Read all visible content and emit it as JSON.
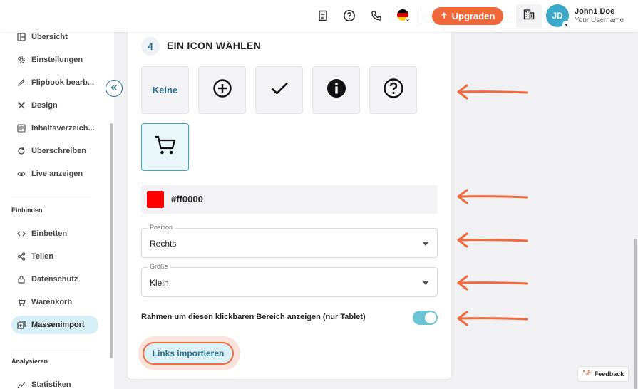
{
  "topbar": {
    "upgrade_label": "Upgraden",
    "user_initials": "JD",
    "user_name": "John1 Doe",
    "user_subtitle": "Your Username"
  },
  "sidebar": {
    "items": [
      {
        "label": "Übersicht",
        "icon": "layout-icon"
      },
      {
        "label": "Einstellungen",
        "icon": "gear-icon"
      },
      {
        "label": "Flipbook bearb...",
        "icon": "pencil-icon"
      },
      {
        "label": "Design",
        "icon": "tools-icon"
      },
      {
        "label": "Inhaltsverzeich...",
        "icon": "list-icon"
      },
      {
        "label": "Überschreiben",
        "icon": "refresh-icon"
      },
      {
        "label": "Live anzeigen",
        "icon": "eye-icon"
      }
    ],
    "section_embed": "Einbinden",
    "embed_items": [
      {
        "label": "Einbetten",
        "icon": "code-icon"
      },
      {
        "label": "Teilen",
        "icon": "share-icon"
      },
      {
        "label": "Datenschutz",
        "icon": "lock-icon"
      },
      {
        "label": "Warenkorb",
        "icon": "cart-icon"
      },
      {
        "label": "Massenimport",
        "icon": "import-icon",
        "active": true
      }
    ],
    "section_analytics": "Analysieren",
    "analytics_items": [
      {
        "label": "Statistiken",
        "icon": "chart-icon"
      }
    ]
  },
  "main": {
    "step_number": "4",
    "step_title": "EIN ICON WÄHLEN",
    "icon_options": [
      {
        "label": "Keine",
        "icon": "none"
      },
      {
        "label": "",
        "icon": "plus-circle-icon"
      },
      {
        "label": "",
        "icon": "check-icon"
      },
      {
        "label": "",
        "icon": "info-icon"
      },
      {
        "label": "",
        "icon": "question-circle-icon"
      },
      {
        "label": "",
        "icon": "cart-icon",
        "selected": true
      }
    ],
    "color": {
      "value": "#ff0000"
    },
    "position": {
      "label": "Position",
      "value": "Rechts"
    },
    "size": {
      "label": "Größe",
      "value": "Klein"
    },
    "frame_toggle": {
      "label": "Rahmen um diesen klickbaren Bereich anzeigen (nur Tablet)",
      "on": true
    },
    "import_button": "Links importieren"
  },
  "feedback_label": "Feedback",
  "colors": {
    "accent_orange": "#f0673a",
    "accent_teal": "#3aa7c7",
    "arrow_orange": "#ef6a3e"
  }
}
